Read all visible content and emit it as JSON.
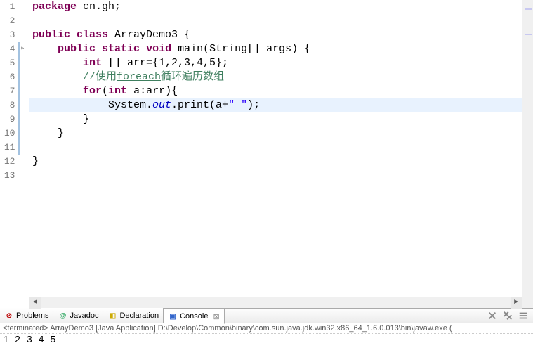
{
  "code": {
    "lines": [
      {
        "no": "1",
        "marker": "",
        "tokens": [
          [
            "kw",
            "package"
          ],
          [
            "txt",
            " cn.gh;"
          ]
        ]
      },
      {
        "no": "2",
        "marker": "",
        "tokens": []
      },
      {
        "no": "3",
        "marker": "",
        "tokens": [
          [
            "kw",
            "public"
          ],
          [
            "txt",
            " "
          ],
          [
            "kw",
            "class"
          ],
          [
            "txt",
            " ArrayDemo3 {"
          ]
        ]
      },
      {
        "no": "4",
        "marker": "▹",
        "tokens": [
          [
            "txt",
            "    "
          ],
          [
            "kw",
            "public"
          ],
          [
            "txt",
            " "
          ],
          [
            "kw",
            "static"
          ],
          [
            "txt",
            " "
          ],
          [
            "kw",
            "void"
          ],
          [
            "txt",
            " main(String[] args) {"
          ]
        ]
      },
      {
        "no": "5",
        "marker": "",
        "tokens": [
          [
            "txt",
            "        "
          ],
          [
            "kw",
            "int"
          ],
          [
            "txt",
            " [] arr={1,2,3,4,5};"
          ]
        ]
      },
      {
        "no": "6",
        "marker": "",
        "tokens": [
          [
            "txt",
            "        "
          ],
          [
            "com",
            "//使用"
          ],
          [
            "com-u",
            "foreach"
          ],
          [
            "com",
            "循环遍历数组"
          ]
        ]
      },
      {
        "no": "7",
        "marker": "",
        "tokens": [
          [
            "txt",
            "        "
          ],
          [
            "kw",
            "for"
          ],
          [
            "txt",
            "("
          ],
          [
            "kw",
            "int"
          ],
          [
            "txt",
            " a:arr){"
          ]
        ]
      },
      {
        "no": "8",
        "marker": "",
        "hl": true,
        "tokens": [
          [
            "txt",
            "            System."
          ],
          [
            "fld",
            "out"
          ],
          [
            "txt",
            ".print(a+"
          ],
          [
            "str",
            "\" \""
          ],
          [
            "txt",
            ");"
          ]
        ]
      },
      {
        "no": "9",
        "marker": "",
        "tokens": [
          [
            "txt",
            "        }"
          ]
        ]
      },
      {
        "no": "10",
        "marker": "",
        "tokens": [
          [
            "txt",
            "    }"
          ]
        ]
      },
      {
        "no": "11",
        "marker": "",
        "tokens": []
      },
      {
        "no": "12",
        "marker": "",
        "tokens": [
          [
            "txt",
            "}"
          ]
        ]
      },
      {
        "no": "13",
        "marker": "",
        "tokens": []
      }
    ]
  },
  "tabs": {
    "problems": "Problems",
    "javadoc": "Javadoc",
    "declaration": "Declaration",
    "console": "Console"
  },
  "console": {
    "header": "<terminated> ArrayDemo3 [Java Application] D:\\Develop\\Common\\binary\\com.sun.java.jdk.win32.x86_64_1.6.0.013\\bin\\javaw.exe (",
    "output": "1 2 3 4 5 "
  }
}
